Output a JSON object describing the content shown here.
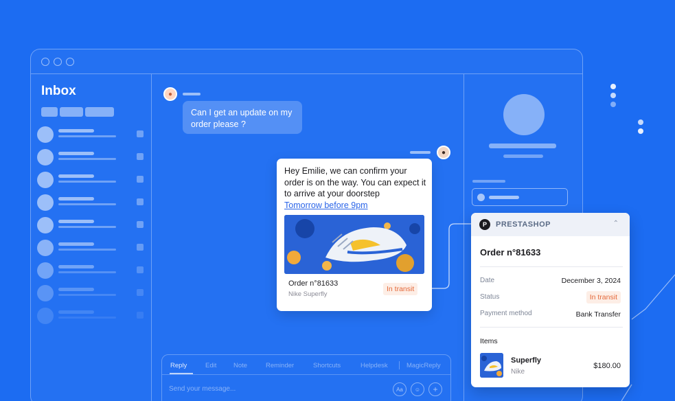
{
  "colors": {
    "background": "#1c6cf2",
    "link": "#2a64e8",
    "in_transit_text": "#e4693a",
    "in_transit_bg": "#fdeee6"
  },
  "inbox": {
    "title": "Inbox"
  },
  "chat": {
    "incoming_message": "Can I get an update on my order please ?",
    "outgoing_message": "Hey Emilie, we can confirm your order is on the way. You can expect it to arrive at your doorstep",
    "outgoing_link": "Tomorrow before 9pm",
    "card": {
      "order": "Order n°81633",
      "product": "Nike Superfly",
      "status": "In transit"
    }
  },
  "composer": {
    "tabs": [
      "Reply",
      "Edit",
      "Note",
      "Reminder",
      "Shortcuts",
      "Helpdesk",
      "MagicReply"
    ],
    "placeholder": "Send your message...",
    "icons": [
      "text-format-icon",
      "emoji-icon",
      "add-icon"
    ]
  },
  "prestashop": {
    "brand": "PRESTASHOP",
    "order_title": "Order n°81633",
    "date_label": "Date",
    "date_value": "December 3, 2024",
    "status_label": "Status",
    "status_value": "In transit",
    "payment_label": "Payment method",
    "payment_value": "Bank Transfer",
    "items_label": "Items",
    "item": {
      "name": "Superfly",
      "brand": "Nike",
      "price": "$180.00"
    }
  }
}
